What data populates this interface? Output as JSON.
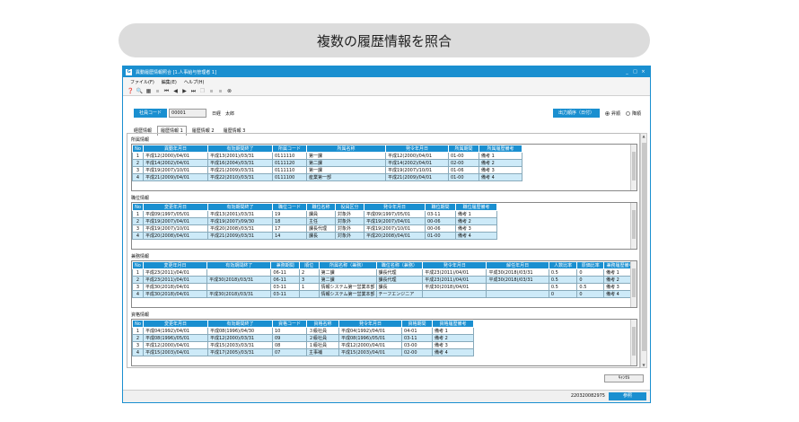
{
  "banner": {
    "title": "複数の履歴情報を照合"
  },
  "window": {
    "title": "異動履歴情報照合 [1.人事給与管理者 1]",
    "app_icon": "G"
  },
  "menu": [
    "ファイル(F)",
    "編集(E)",
    "ヘルプ(H)"
  ],
  "search": {
    "code_label": "社員コード",
    "code_value": "00001",
    "employee_name": "日経　太郎",
    "order_label": "出力順序（日付）",
    "asc_label": "昇順",
    "desc_label": "降順"
  },
  "tabs": [
    "経歴情報",
    "履歴情報 1",
    "履歴情報 2",
    "履歴情報 3"
  ],
  "sections": [
    {
      "title": "所属情報",
      "headers": [
        "No",
        "異動年月日",
        "有効期間終了",
        "所属コード",
        "所属名称",
        "発令年月日",
        "所属期間",
        "所属履歴備考"
      ],
      "widths": [
        12,
        72,
        72,
        38,
        88,
        70,
        34,
        48
      ],
      "rows": [
        [
          "1",
          "平成12(2000)/04/01",
          "平成13(2001)/03/31",
          "0111110",
          "第一課",
          "平成12(2000)/04/01",
          "01-00",
          "備考 1"
        ],
        [
          "2",
          "平成14(2002)/04/01",
          "平成16(2004)/03/31",
          "0111120",
          "第二課",
          "平成14(2002)/04/01",
          "02-00",
          "備考 2"
        ],
        [
          "3",
          "平成19(2007)/10/01",
          "平成21(2009)/03/31",
          "0111110",
          "第一課",
          "平成19(2007)/10/01",
          "01-06",
          "備考 3"
        ],
        [
          "4",
          "平成21(2009)/04/01",
          "平成22(2010)/03/31",
          "0111100",
          "産業第一部",
          "平成21(2009)/04/01",
          "01-00",
          "備考 4"
        ]
      ]
    },
    {
      "title": "職位情報",
      "headers": [
        "No",
        "変更年月日",
        "有効期間終了",
        "職位コード",
        "職位名称",
        "役員区分",
        "発令年月日",
        "職位期間",
        "職位履歴備考"
      ],
      "widths": [
        12,
        72,
        72,
        38,
        32,
        32,
        68,
        34,
        46
      ],
      "rows": [
        [
          "1",
          "平成09(1997)/05/01",
          "平成13(2001)/03/31",
          "19",
          "課員",
          "対象外",
          "平成09(1997)/05/01",
          "03-11",
          "備考 1"
        ],
        [
          "2",
          "平成19(2007)/04/01",
          "平成19(2007)/09/30",
          "18",
          "主任",
          "対象外",
          "平成19(2007)/04/01",
          "00-06",
          "備考 2"
        ],
        [
          "3",
          "平成19(2007)/10/01",
          "平成20(2008)/03/31",
          "17",
          "課長代理",
          "対象外",
          "平成19(2007)/10/01",
          "00-06",
          "備考 3"
        ],
        [
          "4",
          "平成20(2008)/04/01",
          "平成21(2009)/03/31",
          "14",
          "課長",
          "対象外",
          "平成20(2008)/04/01",
          "01-00",
          "備考 4"
        ]
      ]
    },
    {
      "title": "兼務情報",
      "headers": [
        "No",
        "変更年月日",
        "有効期間終了",
        "兼務期間",
        "順位",
        "所属名称（兼務）",
        "職位名称（兼務）",
        "発令年月日",
        "解任年月日",
        "人数比率",
        "原価比率",
        "兼務履歴備考"
      ],
      "widths": [
        12,
        72,
        72,
        32,
        22,
        64,
        52,
        72,
        70,
        32,
        30,
        36
      ],
      "rows": [
        [
          "1",
          "平成23(2011)/04/01",
          "",
          "06-11",
          "2",
          "第二課",
          "課長代理",
          "平成23(2011)/04/01",
          "平成30(2018)/03/31",
          "0.5",
          "0",
          "備考 1"
        ],
        [
          "2",
          "平成23(2011)/04/01",
          "平成30(2018)/03/31",
          "06-11",
          "3",
          "第二課",
          "課長代理",
          "平成23(2011)/04/01",
          "平成30(2018)/03/31",
          "0.5",
          "0",
          "備考 2"
        ],
        [
          "3",
          "平成30(2018)/04/01",
          "",
          "03-11",
          "1",
          "情報システム第一営業本部",
          "課長",
          "平成30(2018)/04/01",
          "",
          "0.5",
          "0.5",
          "備考 3"
        ],
        [
          "4",
          "平成30(2018)/04/01",
          "平成30(2018)/03/31",
          "03-11",
          "",
          "情報システム第一営業本部",
          "チーフエンジニア",
          "",
          "",
          "0",
          "0",
          "備考 4"
        ]
      ]
    },
    {
      "title": "資格情報",
      "headers": [
        "No",
        "変更年月日",
        "有効期間終了",
        "資格コード",
        "資格名称",
        "発令年月日",
        "資格期間",
        "資格履歴備考"
      ],
      "widths": [
        12,
        72,
        72,
        38,
        36,
        70,
        34,
        46
      ],
      "rows": [
        [
          "1",
          "平成04(1992)/04/01",
          "平成08(1996)/04/30",
          "10",
          "３級社員",
          "平成04(1992)/04/01",
          "04-01",
          "備考 1"
        ],
        [
          "2",
          "平成08(1996)/05/01",
          "平成12(2000)/03/31",
          "09",
          "２級社員",
          "平成08(1996)/05/01",
          "03-11",
          "備考 2"
        ],
        [
          "3",
          "平成12(2000)/04/01",
          "平成15(2003)/03/31",
          "08",
          "１級社員",
          "平成12(2000)/04/01",
          "03-00",
          "備考 3"
        ],
        [
          "4",
          "平成15(2003)/04/01",
          "平成17(2005)/03/31",
          "07",
          "主事補",
          "平成15(2003)/04/01",
          "02-00",
          "備考 4"
        ]
      ]
    }
  ],
  "buttons": {
    "cancel": "ｷｬﾝｾﾙ",
    "reference": "参照"
  },
  "status": {
    "id": "220320082975"
  },
  "colors": {
    "accent": "#1a8fd0",
    "row_alt": "#cdeaf8"
  }
}
